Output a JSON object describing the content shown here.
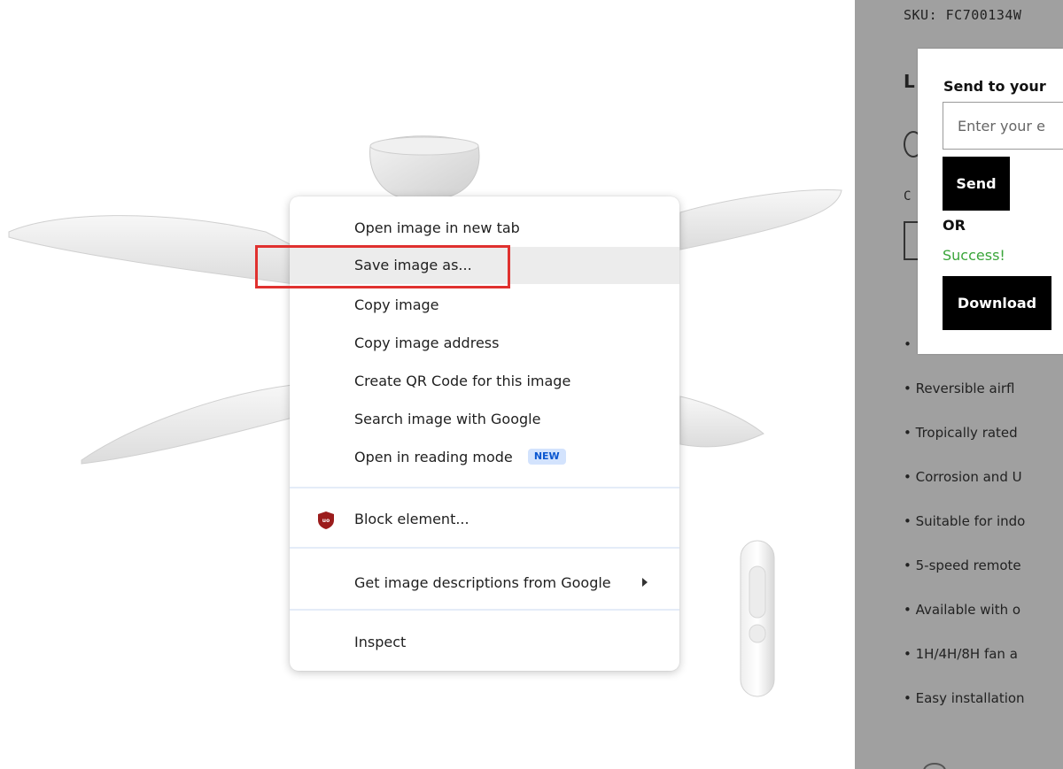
{
  "context_menu": {
    "items": [
      {
        "label": "Open image in new tab"
      },
      {
        "label": "Save image as..."
      },
      {
        "label": "Copy image"
      },
      {
        "label": "Copy image address"
      },
      {
        "label": "Create QR Code for this image"
      },
      {
        "label": "Search image with Google"
      },
      {
        "label": "Open in reading mode",
        "badge": "NEW"
      },
      {
        "label": "Block element...",
        "icon": "ublock-origin-icon"
      },
      {
        "label": "Get image descriptions from Google",
        "icon": "submenu-arrow-icon"
      },
      {
        "label": "Inspect"
      }
    ],
    "highlighted_item": "Save image as...",
    "annotation_color": "#e0312f"
  },
  "product_panel": {
    "sku": "SKU: FC700134W",
    "heading_fragment": "L",
    "label_fragment": "C",
    "features": [
      "• Reversible airfl",
      "• Tropically rated",
      "• Corrosion and U",
      "• Suitable for indo",
      "• 5-speed remote",
      "• Available with o",
      "• 1H/4H/8H fan a",
      "• Easy installation"
    ],
    "top_bullet": "•"
  },
  "send_popup": {
    "title": "Send to your",
    "email_placeholder": "Enter your e",
    "send_label": "Send",
    "or_label": "OR",
    "success_label": "Success!",
    "download_label": "Download",
    "success_color": "#3aa53a"
  }
}
